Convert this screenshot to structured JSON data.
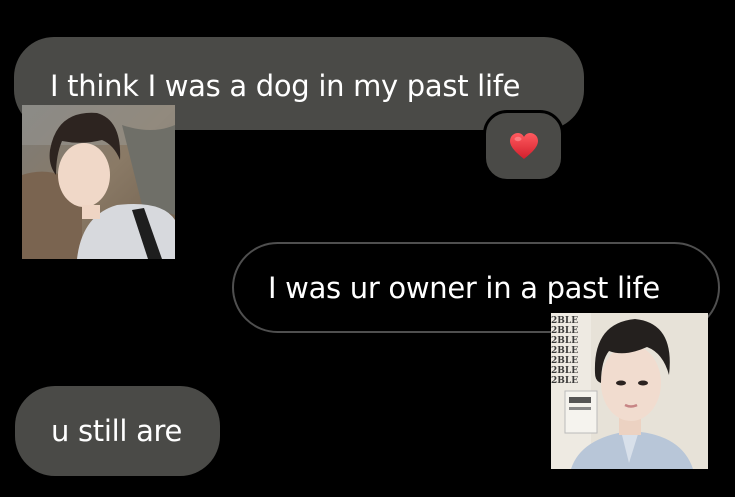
{
  "messages": [
    {
      "direction": "incoming",
      "text": "I think I was a dog in my past life"
    },
    {
      "direction": "outgoing",
      "text": "I was ur owner in a past life"
    },
    {
      "direction": "incoming",
      "text": "u still are"
    }
  ],
  "reaction": {
    "icon": "red-heart-icon",
    "color": "#e8313a"
  },
  "photos": {
    "first": {
      "subject": "selfie of dark-haired person in grey hoodie outdoors"
    },
    "second": {
      "subject": "portrait of dark-haired person in light blue shirt",
      "background_text": "2BLE"
    }
  },
  "colors": {
    "background": "#000000",
    "incoming_bubble": "#4a4a47",
    "outgoing_border": "#4f4f4f",
    "text": "#ffffff"
  }
}
